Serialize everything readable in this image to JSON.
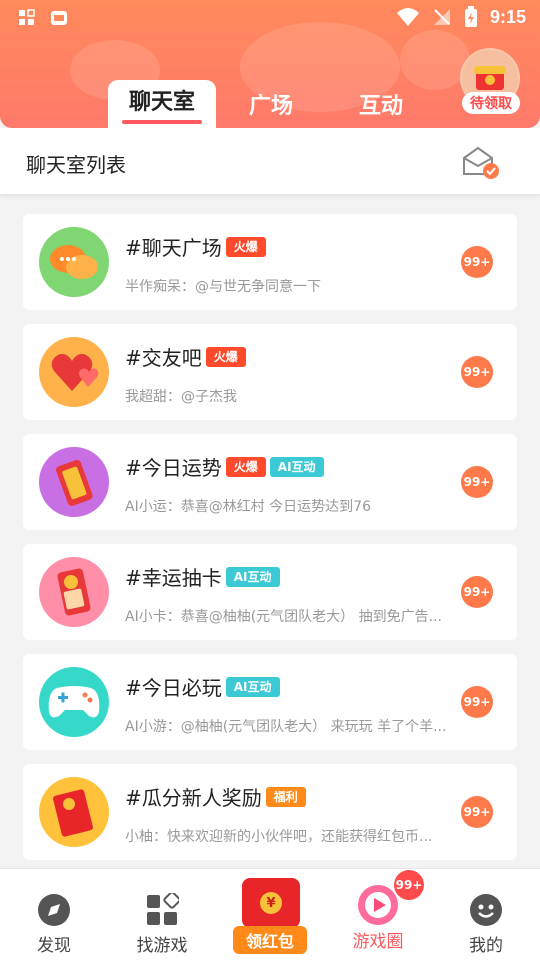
{
  "statusbar": {
    "time": "9:15"
  },
  "header": {
    "tabs": [
      {
        "label": "聊天室"
      },
      {
        "label": "广场"
      },
      {
        "label": "互动"
      }
    ],
    "reward_label": "待领取"
  },
  "section": {
    "title": "聊天室列表"
  },
  "rooms": [
    {
      "name": "#聊天广场",
      "tags": [
        {
          "text": "火爆",
          "color": "#ff4a2b"
        }
      ],
      "sub": "半作痴呆：@与世无争同意一下",
      "badge": "99+",
      "avatar_color": "#7fd672"
    },
    {
      "name": "#交友吧",
      "tags": [
        {
          "text": "火爆",
          "color": "#ff4a2b"
        }
      ],
      "sub": "我超甜：@子杰我",
      "badge": "99+",
      "avatar_color": "#ffb14a"
    },
    {
      "name": "#今日运势",
      "tags": [
        {
          "text": "火爆",
          "color": "#ff4a2b"
        },
        {
          "text": "AI互动",
          "color": "#3cc9d6"
        }
      ],
      "sub": "AI小运：恭喜@林红村 今日运势达到76",
      "badge": "99+",
      "avatar_color": "#c86fe3"
    },
    {
      "name": "#幸运抽卡",
      "tags": [
        {
          "text": "AI互动",
          "color": "#3cc9d6"
        }
      ],
      "sub": "AI小卡：恭喜@柚柚(元气团队老大） 抽到免广告...",
      "badge": "99+",
      "avatar_color": "#ff8fa8"
    },
    {
      "name": "#今日必玩",
      "tags": [
        {
          "text": "AI互动",
          "color": "#3cc9d6"
        }
      ],
      "sub": "AI小游：@柚柚(元气团队老大） 来玩玩 羊了个羊...",
      "badge": "99+",
      "avatar_color": "#36d8c9"
    },
    {
      "name": "#瓜分新人奖励",
      "tags": [
        {
          "text": "福利",
          "color": "#ff8a1a"
        }
      ],
      "sub": "小柚：快来欢迎新的小伙伴吧，还能获得红包币...",
      "badge": "99+",
      "avatar_color": "#ffc23a"
    }
  ],
  "bottomnav": {
    "items": [
      {
        "label": "发现",
        "icon": "compass-icon"
      },
      {
        "label": "找游戏",
        "icon": "blocks-icon"
      },
      {
        "label": "领红包",
        "icon": "red-packet-icon"
      },
      {
        "label": "游戏圈",
        "icon": "play-circle-icon"
      },
      {
        "label": "我的",
        "icon": "face-icon"
      }
    ],
    "active_index": 3,
    "game_circle_badge": "99+"
  },
  "colors": {
    "accent": "#ff5a5f",
    "header": "#ff8a5c",
    "badge": "#ff7a4a"
  }
}
